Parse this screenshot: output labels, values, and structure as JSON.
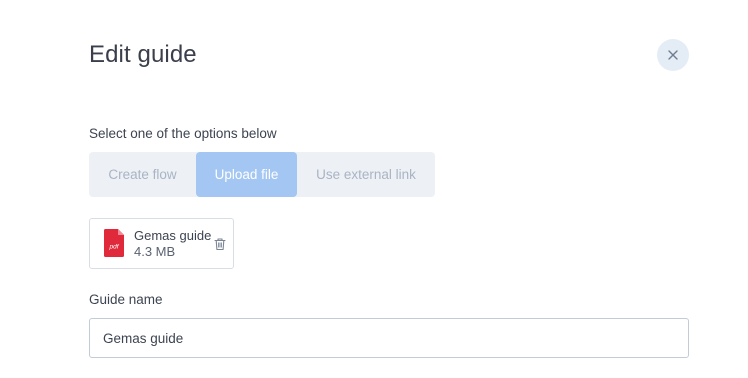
{
  "dialog": {
    "title": "Edit guide",
    "close_icon": "close-icon"
  },
  "options": {
    "label": "Select one of the options below",
    "tabs": [
      {
        "label": "Create flow",
        "active": false
      },
      {
        "label": "Upload file",
        "active": true
      },
      {
        "label": "Use external link",
        "active": false
      }
    ]
  },
  "file": {
    "icon": "pdf-file-icon",
    "icon_text": "pdf",
    "name": "Gemas guide",
    "size": "4.3 MB",
    "delete_icon": "trash-icon"
  },
  "guide_name": {
    "label": "Guide name",
    "value": "Gemas guide"
  },
  "colors": {
    "active_tab": "#a4c6f2",
    "tab_bg": "#edf1f6",
    "pdf_red": "#e0293a",
    "close_bg": "#e4edf6"
  }
}
